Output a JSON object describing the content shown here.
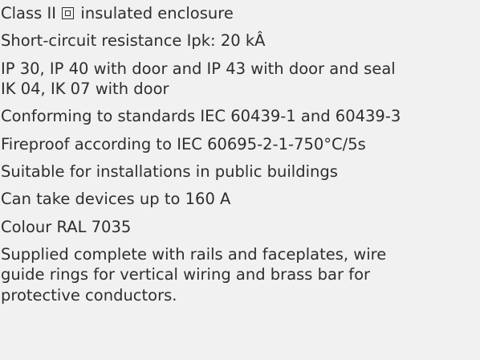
{
  "specs": {
    "class": {
      "prefix": "Class II",
      "suffix": "insulated enclosure"
    },
    "short_circuit": "Short-circuit resistance Ipk: 20 kÂ",
    "ip_rating": "IP 30, IP 40 with door and IP 43 with door and seal",
    "ik_rating": "IK 04, IK 07 with door",
    "standards": "Conforming to standards IEC 60439-1 and 60439-3",
    "fireproof": "Fireproof according to IEC 60695-2-1-750°C/5s",
    "public_buildings": "Suitable for installations in public buildings",
    "devices": "Can take devices up to 160 A",
    "colour": "Colour RAL 7035",
    "supplied": {
      "line1": "Supplied complete with rails and faceplates, wire",
      "line2": "guide rings for vertical wiring and brass bar for",
      "line3": "protective conductors."
    }
  }
}
